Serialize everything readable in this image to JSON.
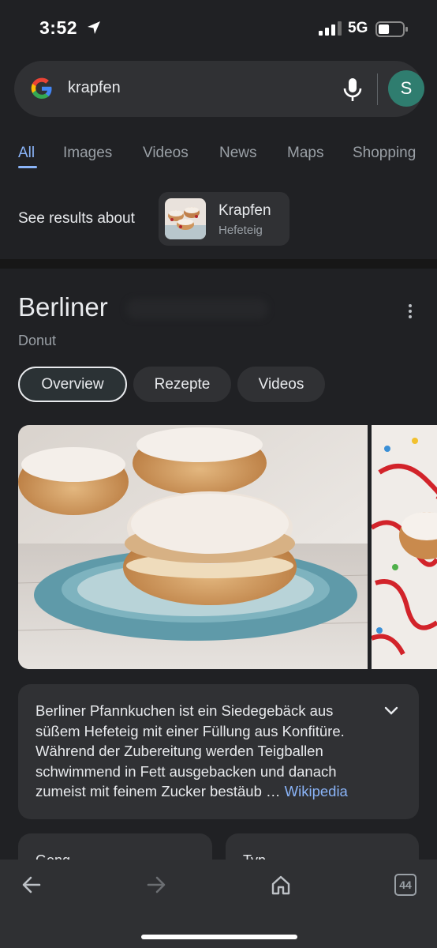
{
  "status_bar": {
    "time": "3:52",
    "network": "5G",
    "battery_level": 0.45
  },
  "search": {
    "query": "krapfen"
  },
  "account": {
    "initial": "S"
  },
  "tabs": [
    "All",
    "Images",
    "Videos",
    "News",
    "Maps",
    "Shopping"
  ],
  "active_tab": "All",
  "see_results": {
    "label": "See results about",
    "title": "Krapfen",
    "subtitle": "Hefeteig"
  },
  "knowledge_panel": {
    "title": "Berliner",
    "subtitle": "Donut",
    "pills": [
      "Overview",
      "Rezepte",
      "Videos"
    ],
    "active_pill": "Overview",
    "description": "Berliner Pfannkuchen ist ein Siedegebäck aus süßem Hefeteig mit einer Füllung aus Konfitüre. Während der Zubereitung werden Teigballen schwimmend in Fett ausgebacken und danach zumeist mit feinem Zucker bestäub",
    "ellipsis": "…",
    "source_link": "Wikipedia",
    "cards": [
      "Geng",
      "Typ"
    ]
  },
  "toolbar": {
    "tab_count": "44"
  },
  "colors": {
    "background": "#202124",
    "surface": "#303134",
    "accent": "#8ab4f8",
    "avatar": "#2f7d6f"
  }
}
